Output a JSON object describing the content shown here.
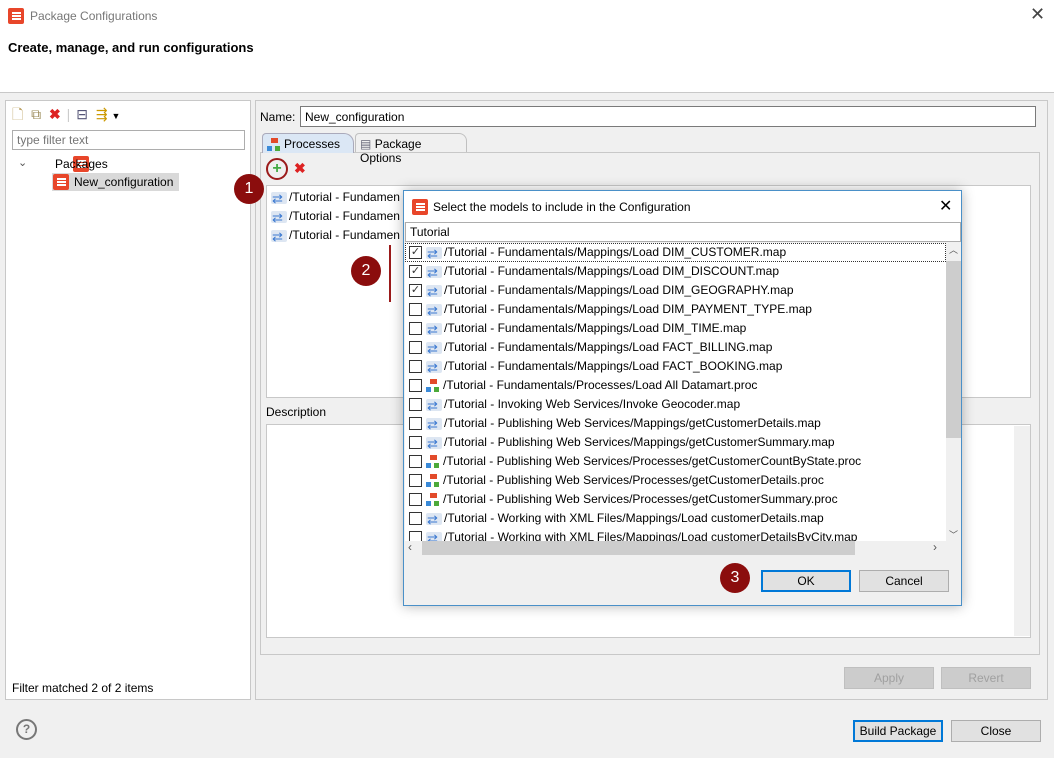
{
  "window": {
    "title": "Package Configurations",
    "header": "Create, manage, and run configurations"
  },
  "left": {
    "filter_placeholder": "type filter text",
    "tree": {
      "root": "Packages",
      "child": "New_configuration"
    },
    "status": "Filter matched 2 of 2 items"
  },
  "right": {
    "name_label": "Name:",
    "name_value": "New_configuration",
    "tabs": [
      {
        "label": "Processes",
        "selected": true
      },
      {
        "label": "Package Options",
        "selected": false
      }
    ],
    "processes": [
      "/Tutorial - Fundamen",
      "/Tutorial - Fundamen",
      "/Tutorial - Fundamen"
    ],
    "description_label": "Description",
    "apply": "Apply",
    "revert": "Revert"
  },
  "footer": {
    "build": "Build Package",
    "close": "Close"
  },
  "callouts": [
    "1",
    "2",
    "3"
  ],
  "dialog": {
    "title": "Select the models to include in the Configuration",
    "filter": "Tutorial",
    "items": [
      {
        "label": "/Tutorial - Fundamentals/Mappings/Load DIM_CUSTOMER.map",
        "type": "map",
        "checked": true
      },
      {
        "label": "/Tutorial - Fundamentals/Mappings/Load DIM_DISCOUNT.map",
        "type": "map",
        "checked": true
      },
      {
        "label": "/Tutorial - Fundamentals/Mappings/Load DIM_GEOGRAPHY.map",
        "type": "map",
        "checked": true
      },
      {
        "label": "/Tutorial - Fundamentals/Mappings/Load DIM_PAYMENT_TYPE.map",
        "type": "map",
        "checked": false
      },
      {
        "label": "/Tutorial - Fundamentals/Mappings/Load DIM_TIME.map",
        "type": "map",
        "checked": false
      },
      {
        "label": "/Tutorial - Fundamentals/Mappings/Load FACT_BILLING.map",
        "type": "map",
        "checked": false
      },
      {
        "label": "/Tutorial - Fundamentals/Mappings/Load FACT_BOOKING.map",
        "type": "map",
        "checked": false
      },
      {
        "label": "/Tutorial - Fundamentals/Processes/Load All Datamart.proc",
        "type": "proc",
        "checked": false
      },
      {
        "label": "/Tutorial - Invoking Web Services/Invoke Geocoder.map",
        "type": "map",
        "checked": false
      },
      {
        "label": "/Tutorial - Publishing Web Services/Mappings/getCustomerDetails.map",
        "type": "map",
        "checked": false
      },
      {
        "label": "/Tutorial - Publishing Web Services/Mappings/getCustomerSummary.map",
        "type": "map",
        "checked": false
      },
      {
        "label": "/Tutorial - Publishing Web Services/Processes/getCustomerCountByState.proc",
        "type": "proc",
        "checked": false
      },
      {
        "label": "/Tutorial - Publishing Web Services/Processes/getCustomerDetails.proc",
        "type": "proc",
        "checked": false
      },
      {
        "label": "/Tutorial - Publishing Web Services/Processes/getCustomerSummary.proc",
        "type": "proc",
        "checked": false
      },
      {
        "label": "/Tutorial - Working with XML Files/Mappings/Load  customerDetails.map",
        "type": "map",
        "checked": false
      },
      {
        "label": "/Tutorial - Working with XML Files/Mappings/Load  customerDetailsByCity.map",
        "type": "map",
        "checked": false
      }
    ],
    "ok": "OK",
    "cancel": "Cancel"
  },
  "colors": {
    "callout": "#8b0d0d",
    "accent": "#0078d7",
    "brand": "#e8462a"
  }
}
